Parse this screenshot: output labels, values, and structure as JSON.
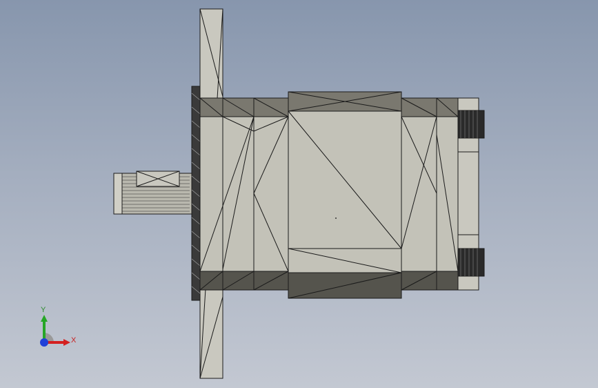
{
  "viewport": {
    "background_top": "#8796ad",
    "background_bottom": "#c3c8d2"
  },
  "model": {
    "description_icon": "cad-part-icon",
    "face_color": "#c3c2b8",
    "shade_color": "#6c6a62",
    "dark_color": "#1e1e1e"
  },
  "triad": {
    "x_label": "X",
    "y_label": "Y",
    "x_color": "#d42020",
    "y_color": "#26a626",
    "z_color": "#2040d8"
  }
}
